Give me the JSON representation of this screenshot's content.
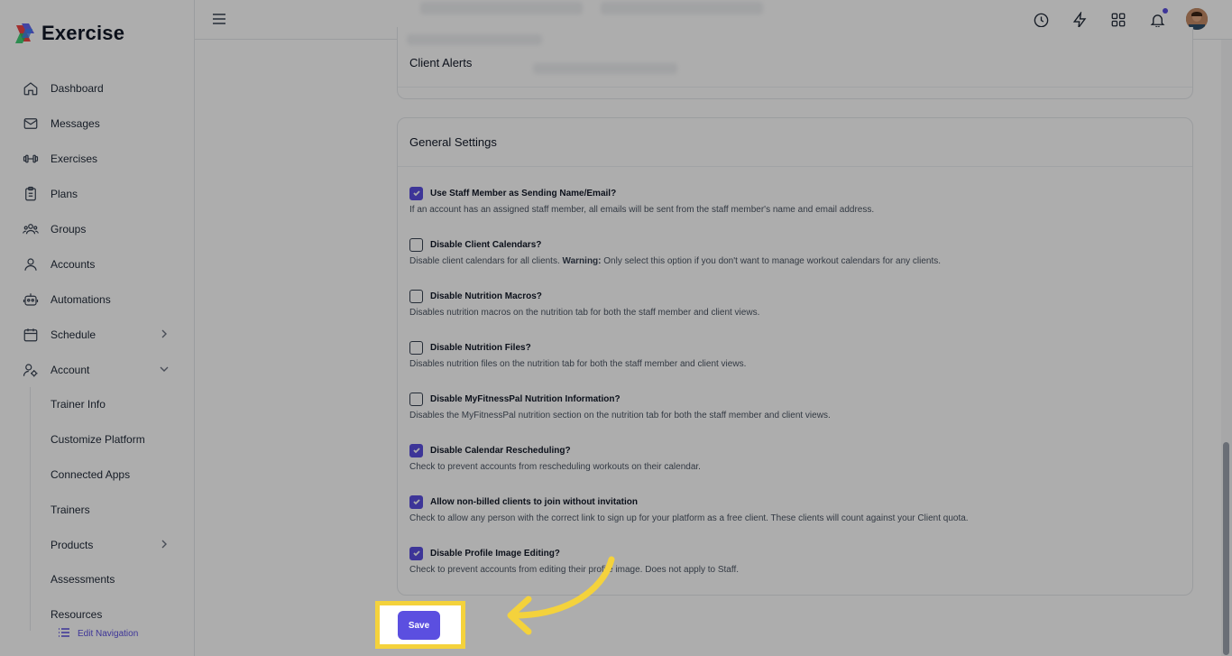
{
  "brand": {
    "name": "Exercise"
  },
  "sidebar": {
    "items": [
      {
        "label": "Dashboard",
        "icon": "home-icon"
      },
      {
        "label": "Messages",
        "icon": "mail-icon"
      },
      {
        "label": "Exercises",
        "icon": "dumbbell-icon"
      },
      {
        "label": "Plans",
        "icon": "clipboard-icon"
      },
      {
        "label": "Groups",
        "icon": "users-icon"
      },
      {
        "label": "Accounts",
        "icon": "user-icon"
      },
      {
        "label": "Automations",
        "icon": "robot-icon"
      },
      {
        "label": "Schedule",
        "icon": "calendar-icon"
      },
      {
        "label": "Account",
        "icon": "user-gear-icon"
      }
    ],
    "sub_items": [
      {
        "label": "Trainer Info"
      },
      {
        "label": "Customize Platform"
      },
      {
        "label": "Connected Apps"
      },
      {
        "label": "Trainers"
      },
      {
        "label": "Products"
      },
      {
        "label": "Assessments"
      },
      {
        "label": "Resources"
      }
    ],
    "edit_navigation": "Edit Navigation"
  },
  "header": {
    "icons": [
      "history-icon",
      "bolt-icon",
      "apps-grid-icon",
      "bell-icon",
      "avatar"
    ]
  },
  "client_alerts": {
    "title": "Client Alerts"
  },
  "general_settings": {
    "title": "General Settings",
    "settings": [
      {
        "label": "Use Staff Member as Sending Name/Email?",
        "checked": true,
        "desc": "If an account has an assigned staff member, all emails will be sent from the staff member's name and email address."
      },
      {
        "label": "Disable Client Calendars?",
        "checked": false,
        "desc_pre": "Disable client calendars for all clients. ",
        "desc_bold": "Warning:",
        "desc": " Only select this option if you don't want to manage workout calendars for any clients."
      },
      {
        "label": "Disable Nutrition Macros?",
        "checked": false,
        "desc": "Disables nutrition macros on the nutrition tab for both the staff member and client views."
      },
      {
        "label": "Disable Nutrition Files?",
        "checked": false,
        "desc": "Disables nutrition files on the nutrition tab for both the staff member and client views."
      },
      {
        "label": "Disable MyFitnessPal Nutrition Information?",
        "checked": false,
        "desc": "Disables the MyFitnessPal nutrition section on the nutrition tab for both the staff member and client views."
      },
      {
        "label": "Disable Calendar Rescheduling?",
        "checked": true,
        "desc": "Check to prevent accounts from rescheduling workouts on their calendar."
      },
      {
        "label": "Allow non-billed clients to join without invitation",
        "checked": true,
        "desc": "Check to allow any person with the correct link to sign up for your platform as a free client. These clients will count against your Client quota."
      },
      {
        "label": "Disable Profile Image Editing?",
        "checked": true,
        "desc": "Check to prevent accounts from editing their profile image. Does not apply to Staff."
      }
    ]
  },
  "save_button": {
    "label": "Save"
  },
  "colors": {
    "accent": "#5b4fe0",
    "highlight": "#f4d23c",
    "overlay": "rgba(0,0,0,0.32)"
  }
}
